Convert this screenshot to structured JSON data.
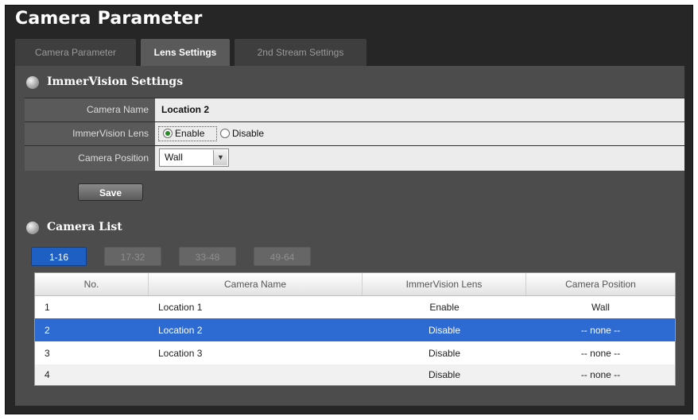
{
  "window": {
    "title": "Camera Parameter"
  },
  "tabs": [
    {
      "label": "Camera Parameter",
      "active": false
    },
    {
      "label": "Lens Settings",
      "active": true
    },
    {
      "label": "2nd Stream Settings",
      "active": false
    }
  ],
  "immervision": {
    "section_title": "ImmerVision Settings",
    "camera_name_label": "Camera Name",
    "camera_name_value": "Location 2",
    "lens_label": "ImmerVision Lens",
    "lens_enable_label": "Enable",
    "lens_disable_label": "Disable",
    "lens_selected": "Enable",
    "position_label": "Camera Position",
    "position_value": "Wall",
    "save_label": "Save"
  },
  "camera_list": {
    "section_title": "Camera List",
    "pages": [
      {
        "label": "1-16",
        "active": true
      },
      {
        "label": "17-32",
        "active": false
      },
      {
        "label": "33-48",
        "active": false
      },
      {
        "label": "49-64",
        "active": false
      }
    ],
    "columns": [
      "No.",
      "Camera Name",
      "ImmerVision Lens",
      "Camera Position"
    ],
    "rows": [
      {
        "no": "1",
        "name": "Location 1",
        "lens": "Enable",
        "position": "Wall"
      },
      {
        "no": "2",
        "name": "Location 2",
        "lens": "Disable",
        "position": "-- none --",
        "selected": true
      },
      {
        "no": "3",
        "name": "Location 3",
        "lens": "Disable",
        "position": "-- none --"
      },
      {
        "no": "4",
        "name": "",
        "lens": "Disable",
        "position": "-- none --"
      }
    ]
  },
  "colors": {
    "accent": "#1e5fc4",
    "selected_row": "#2d6ad2",
    "panel_bg": "#4c4c4c",
    "window_bg": "#262626"
  },
  "icons": {
    "section_bullet": "section-bullet-icon",
    "dropdown_arrow": "chevron-down-icon"
  }
}
